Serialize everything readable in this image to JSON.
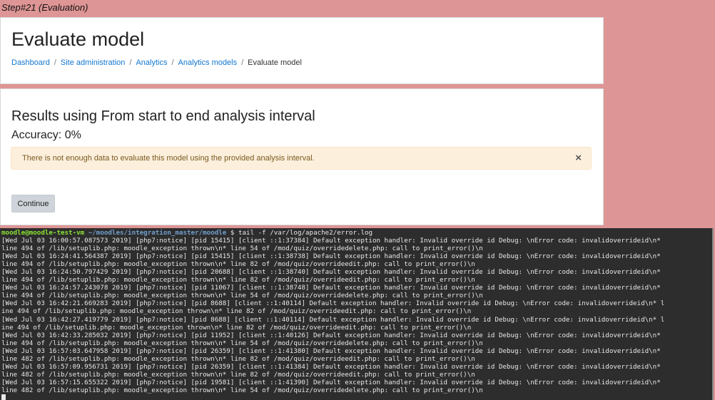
{
  "step_label": "Step#21 (Evaluation)",
  "header": {
    "title": "Evaluate model",
    "breadcrumb": [
      {
        "label": "Dashboard"
      },
      {
        "label": "Site administration"
      },
      {
        "label": "Analytics"
      },
      {
        "label": "Analytics models"
      },
      {
        "label": "Evaluate model"
      }
    ]
  },
  "main": {
    "results_heading": "Results using From start to end analysis interval",
    "accuracy": "Accuracy: 0%",
    "alert_text": "There is not enough data to evaluate this model using the provided analysis interval.",
    "alert_close": "×",
    "continue_label": "Continue"
  },
  "terminal": {
    "prompt_user": "moodle@moodle-test-vm",
    "prompt_path": "~/moodles/integration_master/moodle",
    "prompt_symbol": "$",
    "command": "tail -f /var/log/apache2/error.log",
    "lines": [
      "[Wed Jul 03 16:00:57.087573 2019] [php7:notice] [pid 15415] [client ::1:37384] Default exception handler: Invalid override id Debug: \\nError code: invalidoverrideid\\n*",
      "line 494 of /lib/setuplib.php: moodle_exception thrown\\n* line 54 of /mod/quiz/overridedelete.php: call to print_error()\\n",
      "[Wed Jul 03 16:24:41.564387 2019] [php7:notice] [pid 15415] [client ::1:38738] Default exception handler: Invalid override id Debug: \\nError code: invalidoverrideid\\n*",
      "line 494 of /lib/setuplib.php: moodle_exception thrown\\n* line 82 of /mod/quiz/overrideedit.php: call to print_error()\\n",
      "[Wed Jul 03 16:24:50.797429 2019] [php7:notice] [pid 20688] [client ::1:38740] Default exception handler: Invalid override id Debug: \\nError code: invalidoverrideid\\n*",
      "line 494 of /lib/setuplib.php: moodle_exception thrown\\n* line 82 of /mod/quiz/overrideedit.php: call to print_error()\\n",
      "[Wed Jul 03 16:24:57.243078 2019] [php7:notice] [pid 11067] [client ::1:38748] Default exception handler: Invalid override id Debug: \\nError code: invalidoverrideid\\n*",
      "line 494 of /lib/setuplib.php: moodle_exception thrown\\n* line 54 of /mod/quiz/overridedelete.php: call to print_error()\\n",
      "[Wed Jul 03 16:42:21.669283 2019] [php7:notice] [pid 8688] [client ::1:40114] Default exception handler: Invalid override id Debug: \\nError code: invalidoverrideid\\n* l",
      "ine 494 of /lib/setuplib.php: moodle_exception thrown\\n* line 82 of /mod/quiz/overrideedit.php: call to print_error()\\n",
      "[Wed Jul 03 16:42:27.419779 2019] [php7:notice] [pid 8688] [client ::1:40114] Default exception handler: Invalid override id Debug: \\nError code: invalidoverrideid\\n* l",
      "ine 494 of /lib/setuplib.php: moodle_exception thrown\\n* line 82 of /mod/quiz/overrideedit.php: call to print_error()\\n",
      "[Wed Jul 03 16:42:33.285032 2019] [php7:notice] [pid 11952] [client ::1:40126] Default exception handler: Invalid override id Debug: \\nError code: invalidoverrideid\\n*",
      "line 494 of /lib/setuplib.php: moodle_exception thrown\\n* line 54 of /mod/quiz/overridedelete.php: call to print_error()\\n",
      "[Wed Jul 03 16:57:03.647958 2019] [php7:notice] [pid 26359] [client ::1:41380] Default exception handler: Invalid override id Debug: \\nError code: invalidoverrideid\\n*",
      "line 482 of /lib/setuplib.php: moodle_exception thrown\\n* line 82 of /mod/quiz/overrideedit.php: call to print_error()\\n",
      "[Wed Jul 03 16:57:09.956731 2019] [php7:notice] [pid 26359] [client ::1:41384] Default exception handler: Invalid override id Debug: \\nError code: invalidoverrideid\\n*",
      "line 482 of /lib/setuplib.php: moodle_exception thrown\\n* line 82 of /mod/quiz/overrideedit.php: call to print_error()\\n",
      "[Wed Jul 03 16:57:15.655322 2019] [php7:notice] [pid 19581] [client ::1:41390] Default exception handler: Invalid override id Debug: \\nError code: invalidoverrideid\\n*",
      "line 482 of /lib/setuplib.php: moodle_exception thrown\\n* line 54 of /mod/quiz/overridedelete.php: call to print_error()\\n"
    ]
  }
}
